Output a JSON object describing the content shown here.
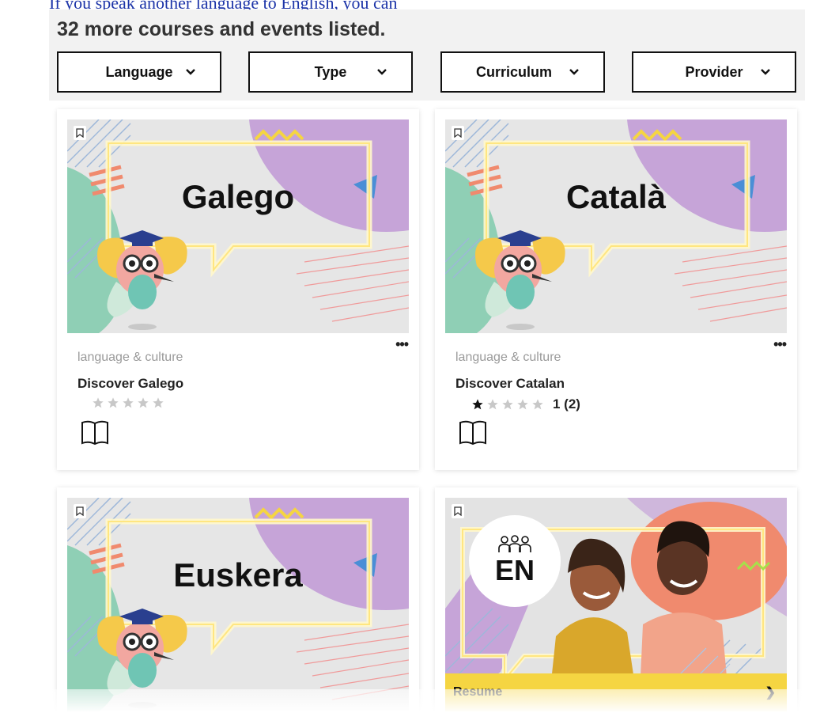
{
  "header": {
    "partial_link_text": "If you speak another language to English, you can",
    "result_count": "32 more courses and events listed."
  },
  "filters": [
    {
      "label": "Language"
    },
    {
      "label": "Type"
    },
    {
      "label": "Curriculum"
    },
    {
      "label": "Provider"
    }
  ],
  "cards": [
    {
      "image_text": "Galego",
      "category": "language & culture",
      "title": "Discover Galego",
      "rating": {
        "filled_stars": 0,
        "total_stars": 5,
        "text": ""
      },
      "type_icon": "book-icon"
    },
    {
      "image_text": "Català",
      "category": "language & culture",
      "title": "Discover Catalan",
      "rating": {
        "filled_stars": 1,
        "total_stars": 5,
        "text": "1 (2)"
      },
      "type_icon": "book-icon"
    },
    {
      "image_text": "Euskera",
      "type_icon": "book-icon"
    },
    {
      "image_badge": "EN",
      "resume_label": "Resume"
    }
  ],
  "colors": {
    "panel_bg": "#f2f2f2",
    "link_blue": "#1c34a8",
    "resume_yellow": "#f5d542",
    "purple_blob": "#c6a4d8",
    "teal_blob": "#8fcfb5",
    "orange_blob": "#f08a6e"
  }
}
